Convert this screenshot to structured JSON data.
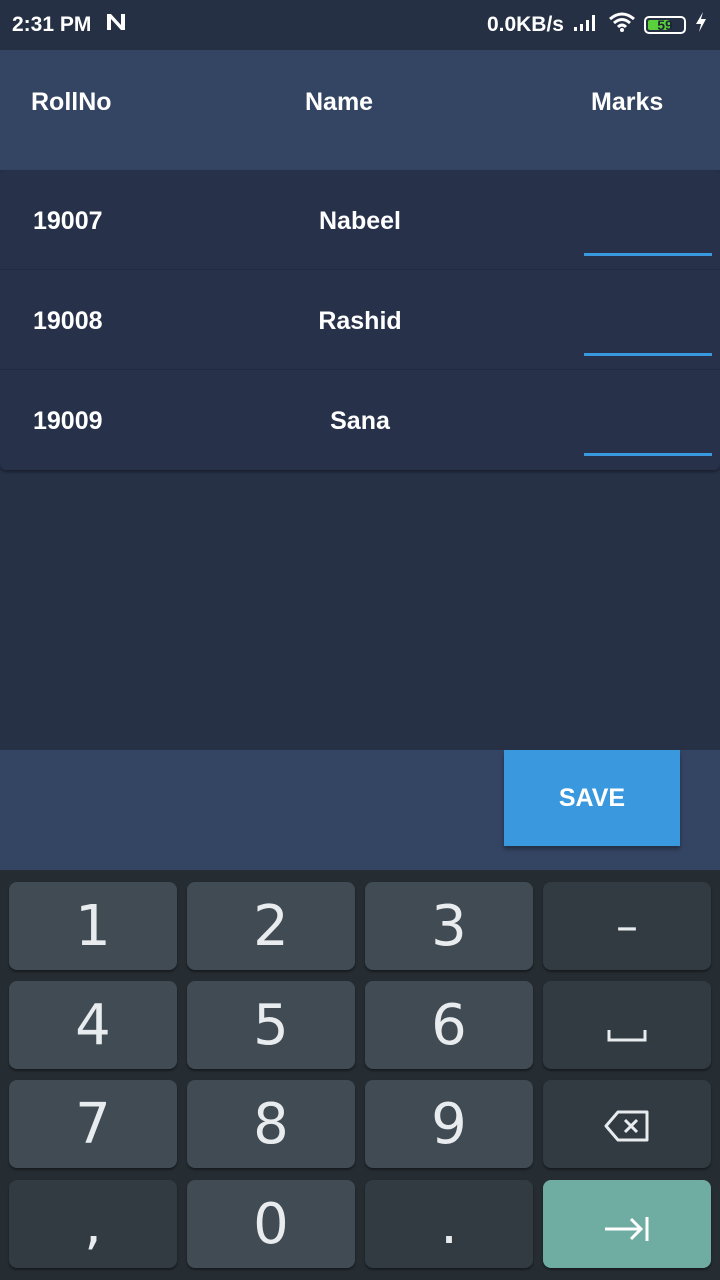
{
  "status_bar": {
    "time": "2:31 PM",
    "notification_icon": "n-icon",
    "network_speed": "0.0KB/s",
    "battery_level": "59",
    "icons": [
      "signal-icon",
      "wifi-icon",
      "battery-icon",
      "charging-icon"
    ]
  },
  "header": {
    "col_rollno": "RollNo",
    "col_name": "Name",
    "col_marks": "Marks"
  },
  "rows": [
    {
      "rollno": "19007",
      "name": "Nabeel",
      "marks": ""
    },
    {
      "rollno": "19008",
      "name": "Rashid",
      "marks": ""
    },
    {
      "rollno": "19009",
      "name": "Sana",
      "marks": ""
    }
  ],
  "footer": {
    "save_label": "SAVE"
  },
  "keyboard": {
    "keys": [
      "1",
      "2",
      "3",
      "–",
      "4",
      "5",
      "6",
      "␣",
      "7",
      "8",
      "9",
      "⌫",
      ",",
      "0",
      ".",
      "⇥"
    ]
  },
  "colors": {
    "accent": "#3a99de",
    "header_bg": "#344563",
    "body_bg": "#263146",
    "enter_key": "#6fada3"
  }
}
